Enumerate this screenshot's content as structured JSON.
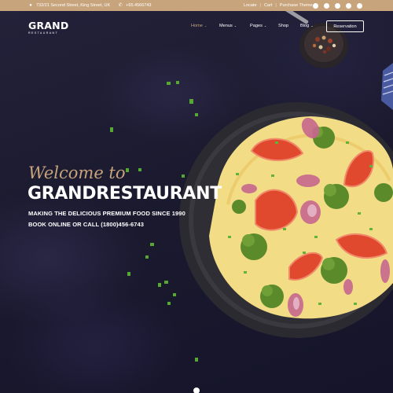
{
  "topbar": {
    "address": "732/21 Second Street, King Street, UK",
    "phone": "+65.4566743",
    "links": [
      "Locate",
      "Cart",
      "Purchase Theme"
    ],
    "social_icons": [
      "facebook-icon",
      "twitter-icon",
      "instagram-icon",
      "tripadvisor-icon",
      "yelp-icon"
    ],
    "accent_color": "#c8a47c"
  },
  "header": {
    "logo_main": "GRAND",
    "logo_sub": "RESTAURANT",
    "nav": [
      {
        "label": "Home",
        "has_dropdown": true,
        "active": true
      },
      {
        "label": "Menus",
        "has_dropdown": true,
        "active": false
      },
      {
        "label": "Pages",
        "has_dropdown": true,
        "active": false
      },
      {
        "label": "Shop",
        "has_dropdown": false,
        "active": false
      },
      {
        "label": "Blog",
        "has_dropdown": true,
        "active": false
      }
    ],
    "reservation_label": "Reservation"
  },
  "hero": {
    "welcome": "Welcome to",
    "title": "GRANDRESTAURANT",
    "line1": "MAKING THE DELICIOUS PREMIUM FOOD SINCE 1990",
    "line2": "BOOK ONLINE OR CALL (1800)456-6743"
  },
  "colors": {
    "background": "#1c1a2e",
    "accent": "#c8a47c",
    "text": "#ffffff"
  }
}
